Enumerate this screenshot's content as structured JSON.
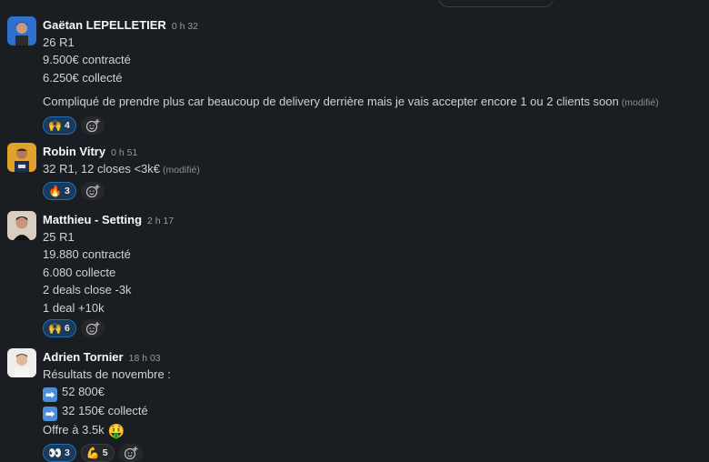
{
  "messages": [
    {
      "author": "Gaëtan LEPELLETIER",
      "time": "0 h 32",
      "lines": [
        "26 R1",
        "9.500€ contracté",
        "6.250€ collecté"
      ],
      "paragraph": "Compliqué de prendre plus car beaucoup de delivery derrière mais je vais accepter encore 1 ou 2 clients soon",
      "edited": "(modifié)",
      "reactions": [
        {
          "emoji": "🙌",
          "count": "4"
        }
      ]
    },
    {
      "author": "Robin Vitry",
      "time": "0 h 51",
      "lines": [
        "32 R1, 12 closes <3k€"
      ],
      "edited": "(modifié)",
      "reactions": [
        {
          "emoji": "🔥",
          "count": "3"
        }
      ]
    },
    {
      "author": "Matthieu - Setting",
      "time": "2 h 17",
      "lines": [
        "25 R1",
        "19.880 contracté",
        "6.080 collecte",
        "2 deals close -3k",
        "1 deal +10k"
      ],
      "reactions": [
        {
          "emoji": "🙌",
          "count": "6"
        }
      ]
    },
    {
      "author": "Adrien Tornier",
      "time": "18 h 03",
      "lines": [
        "Résultats de novembre :",
        "52 800€",
        "32 150€ collecté",
        "Offre à 3.5k"
      ],
      "arrow": "➡",
      "money_emoji": "🤑",
      "reactions": [
        {
          "emoji": "👀",
          "count": "3"
        },
        {
          "emoji": "💪",
          "count": "5"
        }
      ]
    }
  ]
}
